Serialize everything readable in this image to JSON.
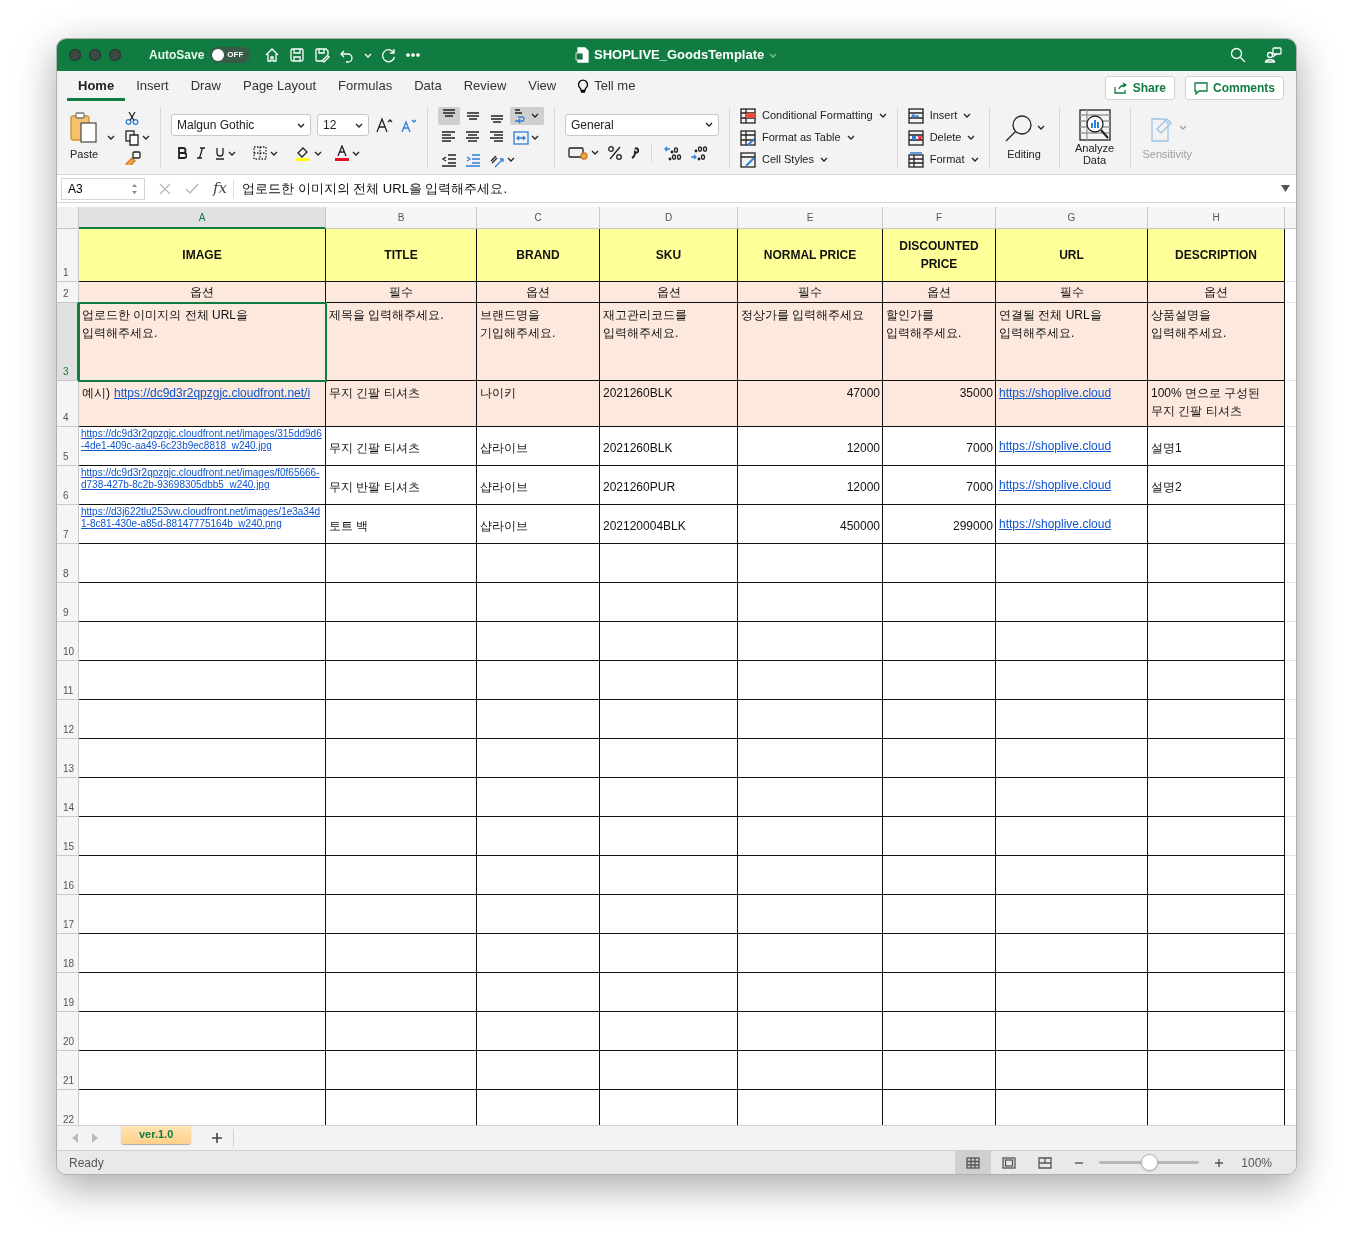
{
  "window": {
    "title": "SHOPLIVE_GoodsTemplate",
    "autosave_label": "AutoSave",
    "autosave_on": false,
    "autosave_state": "OFF"
  },
  "ribbon_tabs": [
    {
      "label": "Home",
      "selected": true
    },
    {
      "label": "Insert",
      "selected": false
    },
    {
      "label": "Draw",
      "selected": false
    },
    {
      "label": "Page Layout",
      "selected": false
    },
    {
      "label": "Formulas",
      "selected": false
    },
    {
      "label": "Data",
      "selected": false
    },
    {
      "label": "Review",
      "selected": false
    },
    {
      "label": "View",
      "selected": false
    }
  ],
  "tell_me": "Tell me",
  "share": "Share",
  "comments": "Comments",
  "ribbon": {
    "paste": "Paste",
    "font_name": "Malgun Gothic",
    "font_size": "12",
    "number_format": "General",
    "styles": [
      "Conditional Formatting",
      "Format as Table",
      "Cell Styles"
    ],
    "cells": [
      "Insert",
      "Delete",
      "Format"
    ],
    "editing": "Editing",
    "analyze": "Analyze Data",
    "sensitivity": {
      "label": "Sensitivity",
      "disabled": true
    }
  },
  "formula_bar": {
    "cell_ref": "A3",
    "function_label": "fx",
    "formula": "업로드한 이미지의 전체 URL을 입력해주세요."
  },
  "columns": [
    {
      "label": "A",
      "selected": true
    },
    {
      "label": "B",
      "selected": false
    },
    {
      "label": "C",
      "selected": false
    },
    {
      "label": "D",
      "selected": false
    },
    {
      "label": "E",
      "selected": false
    },
    {
      "label": "F",
      "selected": false
    },
    {
      "label": "G",
      "selected": false
    },
    {
      "label": "H",
      "selected": false
    }
  ],
  "rows": [
    {
      "number": "1",
      "selected": false,
      "kind": "header",
      "cells": [
        {
          "kind": "text",
          "text": "IMAGE"
        },
        {
          "kind": "text",
          "text": "TITLE"
        },
        {
          "kind": "text",
          "text": "BRAND"
        },
        {
          "kind": "text",
          "text": "SKU"
        },
        {
          "kind": "text",
          "text": "NORMAL PRICE"
        },
        {
          "kind": "text",
          "text": "DISCOUNTED PRICE"
        },
        {
          "kind": "text",
          "text": "URL"
        },
        {
          "kind": "text",
          "text": "DESCRIPTION"
        }
      ]
    },
    {
      "number": "2",
      "selected": false,
      "kind": "requirement",
      "cells": [
        {
          "kind": "text",
          "text": "옵션"
        },
        {
          "kind": "text",
          "text": "필수"
        },
        {
          "kind": "text",
          "text": "옵션"
        },
        {
          "kind": "text",
          "text": "옵션"
        },
        {
          "kind": "text",
          "text": "필수"
        },
        {
          "kind": "text",
          "text": "옵션"
        },
        {
          "kind": "text",
          "text": "필수"
        },
        {
          "kind": "text",
          "text": "옵션"
        }
      ]
    },
    {
      "number": "3",
      "selected": true,
      "kind": "hint",
      "cells": [
        {
          "kind": "text",
          "text": "업로드한 이미지의 전체 URL을\n입력해주세요."
        },
        {
          "kind": "text",
          "text": "제목을 입력해주세요."
        },
        {
          "kind": "text",
          "text": "브랜드명을\n기입해주세요."
        },
        {
          "kind": "text",
          "text": "재고관리코드를\n입력해주세요."
        },
        {
          "kind": "text",
          "text": "정상가를 입력해주세요"
        },
        {
          "kind": "text",
          "text": "할인가를\n입력해주세요."
        },
        {
          "kind": "text",
          "text": "연결될 전체 URL을\n입력해주세요."
        },
        {
          "kind": "text",
          "text": "상품설명을\n입력해주세요."
        }
      ]
    },
    {
      "number": "4",
      "selected": false,
      "kind": "example",
      "cells": [
        {
          "kind": "labeled_link",
          "label": "예시)",
          "text": "https://dc9d3r2qpzgjc.cloudfront.net/i"
        },
        {
          "kind": "text",
          "text": "무지 긴팔 티셔츠"
        },
        {
          "kind": "text",
          "text": "나이키"
        },
        {
          "kind": "text",
          "text": "2021260BLK"
        },
        {
          "kind": "number",
          "text": "47000"
        },
        {
          "kind": "number",
          "text": "35000"
        },
        {
          "kind": "link",
          "text": "https://shoplive.cloud"
        },
        {
          "kind": "text",
          "text": "100% 면으로 구성된\n무지 긴팔 티셔츠"
        }
      ]
    },
    {
      "number": "5",
      "selected": false,
      "kind": "data",
      "cells": [
        {
          "kind": "small_link",
          "text": "https://dc9d3r2qpzgjc.cloudfront.net/images/315dd9d6-4de1-409c-aa49-6c23b9ec8818_w240.jpg"
        },
        {
          "kind": "text",
          "text": "무지 긴팔 티셔츠"
        },
        {
          "kind": "text",
          "text": "샵라이브"
        },
        {
          "kind": "text",
          "text": "2021260BLK"
        },
        {
          "kind": "number",
          "text": "12000"
        },
        {
          "kind": "number",
          "text": "7000"
        },
        {
          "kind": "link",
          "text": "https://shoplive.cloud"
        },
        {
          "kind": "text",
          "text": "설명1"
        }
      ]
    },
    {
      "number": "6",
      "selected": false,
      "kind": "data",
      "cells": [
        {
          "kind": "small_link",
          "text": "https://dc9d3r2qpzgjc.cloudfront.net/images/f0f65666-d738-427b-8c2b-93698305dbb5_w240.jpg"
        },
        {
          "kind": "text",
          "text": "무지 반팔 티셔츠"
        },
        {
          "kind": "text",
          "text": "샵라이브"
        },
        {
          "kind": "text",
          "text": "2021260PUR"
        },
        {
          "kind": "number",
          "text": "12000"
        },
        {
          "kind": "number",
          "text": "7000"
        },
        {
          "kind": "link",
          "text": "https://shoplive.cloud"
        },
        {
          "kind": "text",
          "text": "설명2"
        }
      ]
    },
    {
      "number": "7",
      "selected": false,
      "kind": "data",
      "cells": [
        {
          "kind": "small_link",
          "text": "https://d3j622tlu253vw.cloudfront.net/images/1e3a34d1-8c81-430e-a85d-88147775164b_w240.png"
        },
        {
          "kind": "text",
          "text": "토트 백"
        },
        {
          "kind": "text",
          "text": "샵라이브"
        },
        {
          "kind": "text",
          "text": "202120004BLK"
        },
        {
          "kind": "number",
          "text": "450000"
        },
        {
          "kind": "number",
          "text": "299000"
        },
        {
          "kind": "link",
          "text": "https://shoplive.cloud"
        }
      ]
    },
    {
      "number": "8",
      "selected": false,
      "kind": "data"
    },
    {
      "number": "9",
      "selected": false,
      "kind": "data"
    },
    {
      "number": "10",
      "selected": false,
      "kind": "data"
    },
    {
      "number": "11",
      "selected": false,
      "kind": "data"
    },
    {
      "number": "12",
      "selected": false,
      "kind": "data"
    },
    {
      "number": "13",
      "selected": false,
      "kind": "data"
    },
    {
      "number": "14",
      "selected": false,
      "kind": "data"
    },
    {
      "number": "15",
      "selected": false,
      "kind": "data"
    },
    {
      "number": "16",
      "selected": false,
      "kind": "data"
    },
    {
      "number": "17",
      "selected": false,
      "kind": "data"
    },
    {
      "number": "18",
      "selected": false,
      "kind": "data"
    },
    {
      "number": "19",
      "selected": false,
      "kind": "data"
    },
    {
      "number": "20",
      "selected": false,
      "kind": "data"
    },
    {
      "number": "21",
      "selected": false,
      "kind": "data"
    },
    {
      "number": "22",
      "selected": false,
      "kind": "data"
    }
  ],
  "sheet_tabs": [
    {
      "label": "ver.1.0",
      "selected": true
    }
  ],
  "status_bar": {
    "status": "Ready",
    "zoom": "100%",
    "zoom_slider": {
      "level": 0.5
    }
  }
}
